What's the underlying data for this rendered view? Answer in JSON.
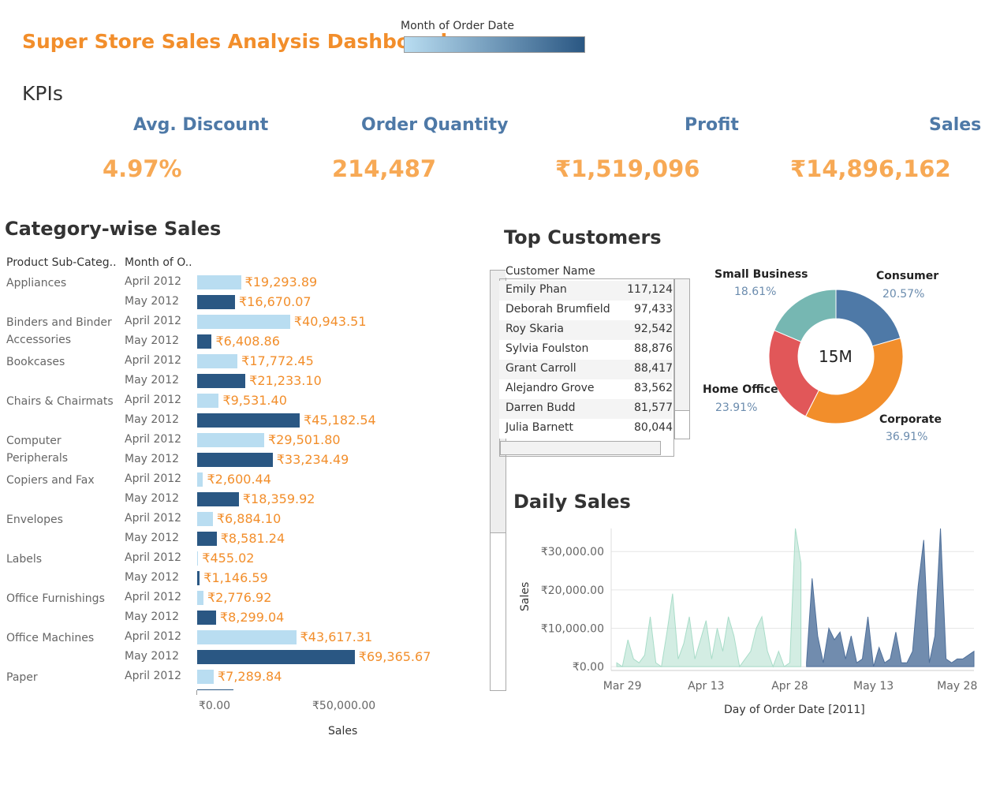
{
  "header": {
    "title": "Super Store Sales Analysis Dashboard",
    "legend_title": "Month of Order Date"
  },
  "kpis": {
    "heading": "KPIs",
    "items": [
      {
        "label": "Avg. Discount",
        "value": "4.97%"
      },
      {
        "label": "Order Quantity",
        "value": "214,487"
      },
      {
        "label": "Profit",
        "value": "₹1,519,096"
      },
      {
        "label": "Sales",
        "value": "₹14,896,162"
      }
    ]
  },
  "category_sales": {
    "heading": "Category-wise Sales",
    "col_headers": [
      "Product Sub-Categ..",
      "Month of O.."
    ],
    "x_axis_label": "Sales",
    "x_ticks": [
      "₹0.00",
      "₹50,000.00"
    ],
    "colors": {
      "april": "#b9ddf1",
      "may": "#2a5783"
    }
  },
  "chart_data": [
    {
      "type": "bar",
      "title": "Category-wise Sales",
      "xlabel": "Sales",
      "categories": [
        "Appliances",
        "Binders and Binder Accessories",
        "Bookcases",
        "Chairs & Chairmats",
        "Computer Peripherals",
        "Copiers and Fax",
        "Envelopes",
        "Labels",
        "Office Furnishings",
        "Office Machines",
        "Paper"
      ],
      "xlim": [
        0,
        100000
      ],
      "rows": [
        {
          "category": "Appliances",
          "month": "April 2012",
          "value": 19293.89,
          "label": "₹19,293.89"
        },
        {
          "category": "",
          "month": "May 2012",
          "value": 16670.07,
          "label": "₹16,670.07"
        },
        {
          "category": "Binders and Binder Accessories",
          "month": "April 2012",
          "value": 40943.51,
          "label": "₹40,943.51"
        },
        {
          "category": "",
          "month": "May 2012",
          "value": 6408.86,
          "label": "₹6,408.86"
        },
        {
          "category": "Bookcases",
          "month": "April 2012",
          "value": 17772.45,
          "label": "₹17,772.45"
        },
        {
          "category": "",
          "month": "May 2012",
          "value": 21233.1,
          "label": "₹21,233.10"
        },
        {
          "category": "Chairs & Chairmats",
          "month": "April 2012",
          "value": 9531.4,
          "label": "₹9,531.40"
        },
        {
          "category": "",
          "month": "May 2012",
          "value": 45182.54,
          "label": "₹45,182.54"
        },
        {
          "category": "Computer Peripherals",
          "month": "April 2012",
          "value": 29501.8,
          "label": "₹29,501.80"
        },
        {
          "category": "",
          "month": "May 2012",
          "value": 33234.49,
          "label": "₹33,234.49"
        },
        {
          "category": "Copiers and Fax",
          "month": "April 2012",
          "value": 2600.44,
          "label": "₹2,600.44"
        },
        {
          "category": "",
          "month": "May 2012",
          "value": 18359.92,
          "label": "₹18,359.92"
        },
        {
          "category": "Envelopes",
          "month": "April 2012",
          "value": 6884.1,
          "label": "₹6,884.10"
        },
        {
          "category": "",
          "month": "May 2012",
          "value": 8581.24,
          "label": "₹8,581.24"
        },
        {
          "category": "Labels",
          "month": "April 2012",
          "value": 455.02,
          "label": "₹455.02"
        },
        {
          "category": "",
          "month": "May 2012",
          "value": 1146.59,
          "label": "₹1,146.59"
        },
        {
          "category": "Office Furnishings",
          "month": "April 2012",
          "value": 2776.92,
          "label": "₹2,776.92"
        },
        {
          "category": "",
          "month": "May 2012",
          "value": 8299.04,
          "label": "₹8,299.04"
        },
        {
          "category": "Office Machines",
          "month": "April 2012",
          "value": 43617.31,
          "label": "₹43,617.31"
        },
        {
          "category": "",
          "month": "May 2012",
          "value": 69365.67,
          "label": "₹69,365.67"
        },
        {
          "category": "Paper",
          "month": "April 2012",
          "value": 7289.84,
          "label": "₹7,289.84"
        }
      ]
    },
    {
      "type": "pie",
      "title": "",
      "center_label": "15M",
      "slices": [
        {
          "name": "Consumer",
          "percent": 20.57,
          "label": "20.57%",
          "color": "#4e79a7"
        },
        {
          "name": "Corporate",
          "percent": 36.91,
          "label": "36.91%",
          "color": "#f28e2b"
        },
        {
          "name": "Home Office",
          "percent": 23.91,
          "label": "23.91%",
          "color": "#e15759"
        },
        {
          "name": "Small Business",
          "percent": 18.61,
          "label": "18.61%",
          "color": "#76b7b2"
        }
      ]
    },
    {
      "type": "area",
      "title": "Daily Sales",
      "xlabel": "Day of Order Date [2011]",
      "ylabel": "Sales",
      "ylim": [
        -1000,
        36000
      ],
      "x_ticks": [
        "Mar 29",
        "Apr 13",
        "Apr 28",
        "May 13",
        "May 28"
      ],
      "y_ticks": [
        "₹30,000.00",
        "₹20,000.00",
        "₹10,000.00",
        "₹0.00"
      ],
      "grid": true,
      "series": [
        {
          "name": "April",
          "color": "#a8dcc8",
          "x": [
            "2011-03-28",
            "2011-03-29",
            "2011-03-30",
            "2011-03-31",
            "2011-04-01",
            "2011-04-02",
            "2011-04-03",
            "2011-04-04",
            "2011-04-05",
            "2011-04-06",
            "2011-04-07",
            "2011-04-08",
            "2011-04-09",
            "2011-04-10",
            "2011-04-11",
            "2011-04-12",
            "2011-04-13",
            "2011-04-14",
            "2011-04-15",
            "2011-04-16",
            "2011-04-17",
            "2011-04-18",
            "2011-04-19",
            "2011-04-20",
            "2011-04-21",
            "2011-04-22",
            "2011-04-23",
            "2011-04-24",
            "2011-04-25",
            "2011-04-26",
            "2011-04-27",
            "2011-04-28",
            "2011-04-29",
            "2011-04-30"
          ],
          "y": [
            1000,
            0,
            7000,
            2000,
            1000,
            3000,
            13000,
            1000,
            0,
            9000,
            19000,
            2000,
            6000,
            13000,
            2000,
            7000,
            12000,
            2000,
            10000,
            4000,
            13000,
            8000,
            0,
            2000,
            4000,
            10000,
            13000,
            4000,
            0,
            4000,
            0,
            1000,
            36000,
            27000
          ]
        },
        {
          "name": "May",
          "color": "#4e6f9a",
          "x": [
            "2011-05-01",
            "2011-05-02",
            "2011-05-03",
            "2011-05-04",
            "2011-05-05",
            "2011-05-06",
            "2011-05-07",
            "2011-05-08",
            "2011-05-09",
            "2011-05-10",
            "2011-05-11",
            "2011-05-12",
            "2011-05-13",
            "2011-05-14",
            "2011-05-15",
            "2011-05-16",
            "2011-05-17",
            "2011-05-18",
            "2011-05-19",
            "2011-05-20",
            "2011-05-21",
            "2011-05-22",
            "2011-05-23",
            "2011-05-24",
            "2011-05-25",
            "2011-05-26",
            "2011-05-27",
            "2011-05-28",
            "2011-05-29",
            "2011-05-30",
            "2011-05-31"
          ],
          "y": [
            1000,
            23000,
            8000,
            1000,
            10000,
            7000,
            9000,
            2000,
            8000,
            1000,
            2000,
            13000,
            0,
            5000,
            1000,
            2000,
            9000,
            1000,
            1000,
            4000,
            21000,
            33000,
            1000,
            8000,
            36000,
            2000,
            1000,
            2000,
            2000,
            3000,
            4000
          ]
        }
      ]
    }
  ],
  "top_customers": {
    "heading": "Top Customers",
    "col_header": "Customer Name",
    "rows": [
      {
        "name": "Emily Phan",
        "value": "117,124"
      },
      {
        "name": "Deborah Brumfield",
        "value": "97,433"
      },
      {
        "name": "Roy Skaria",
        "value": "92,542"
      },
      {
        "name": "Sylvia Foulston",
        "value": "88,876"
      },
      {
        "name": "Grant Carroll",
        "value": "88,417"
      },
      {
        "name": "Alejandro Grove",
        "value": "83,562"
      },
      {
        "name": "Darren Budd",
        "value": "81,577"
      },
      {
        "name": "Julia Barnett",
        "value": "80,044"
      }
    ]
  },
  "daily_sales": {
    "heading": "Daily Sales",
    "ylabel": "Sales",
    "xlabel": "Day of Order Date [2011]"
  }
}
